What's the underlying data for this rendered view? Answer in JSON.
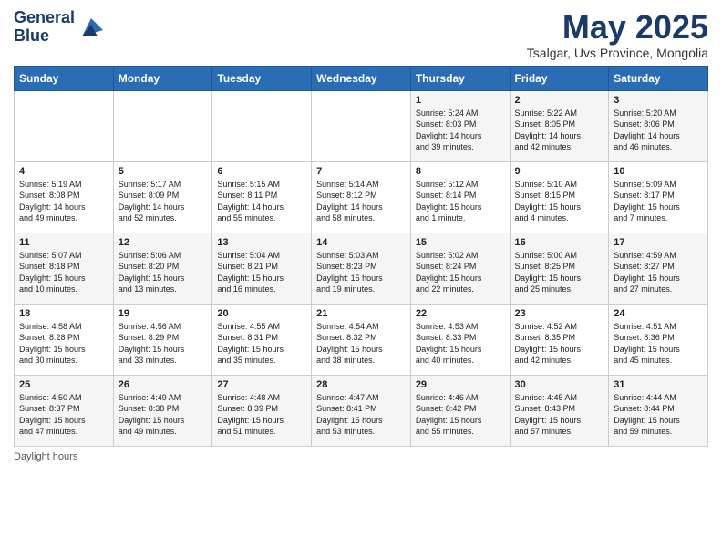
{
  "header": {
    "logo_line1": "General",
    "logo_line2": "Blue",
    "title": "May 2025",
    "subtitle": "Tsalgar, Uvs Province, Mongolia"
  },
  "weekdays": [
    "Sunday",
    "Monday",
    "Tuesday",
    "Wednesday",
    "Thursday",
    "Friday",
    "Saturday"
  ],
  "weeks": [
    [
      {
        "day": "",
        "info": ""
      },
      {
        "day": "",
        "info": ""
      },
      {
        "day": "",
        "info": ""
      },
      {
        "day": "",
        "info": ""
      },
      {
        "day": "1",
        "info": "Sunrise: 5:24 AM\nSunset: 8:03 PM\nDaylight: 14 hours\nand 39 minutes."
      },
      {
        "day": "2",
        "info": "Sunrise: 5:22 AM\nSunset: 8:05 PM\nDaylight: 14 hours\nand 42 minutes."
      },
      {
        "day": "3",
        "info": "Sunrise: 5:20 AM\nSunset: 8:06 PM\nDaylight: 14 hours\nand 46 minutes."
      }
    ],
    [
      {
        "day": "4",
        "info": "Sunrise: 5:19 AM\nSunset: 8:08 PM\nDaylight: 14 hours\nand 49 minutes."
      },
      {
        "day": "5",
        "info": "Sunrise: 5:17 AM\nSunset: 8:09 PM\nDaylight: 14 hours\nand 52 minutes."
      },
      {
        "day": "6",
        "info": "Sunrise: 5:15 AM\nSunset: 8:11 PM\nDaylight: 14 hours\nand 55 minutes."
      },
      {
        "day": "7",
        "info": "Sunrise: 5:14 AM\nSunset: 8:12 PM\nDaylight: 14 hours\nand 58 minutes."
      },
      {
        "day": "8",
        "info": "Sunrise: 5:12 AM\nSunset: 8:14 PM\nDaylight: 15 hours\nand 1 minute."
      },
      {
        "day": "9",
        "info": "Sunrise: 5:10 AM\nSunset: 8:15 PM\nDaylight: 15 hours\nand 4 minutes."
      },
      {
        "day": "10",
        "info": "Sunrise: 5:09 AM\nSunset: 8:17 PM\nDaylight: 15 hours\nand 7 minutes."
      }
    ],
    [
      {
        "day": "11",
        "info": "Sunrise: 5:07 AM\nSunset: 8:18 PM\nDaylight: 15 hours\nand 10 minutes."
      },
      {
        "day": "12",
        "info": "Sunrise: 5:06 AM\nSunset: 8:20 PM\nDaylight: 15 hours\nand 13 minutes."
      },
      {
        "day": "13",
        "info": "Sunrise: 5:04 AM\nSunset: 8:21 PM\nDaylight: 15 hours\nand 16 minutes."
      },
      {
        "day": "14",
        "info": "Sunrise: 5:03 AM\nSunset: 8:23 PM\nDaylight: 15 hours\nand 19 minutes."
      },
      {
        "day": "15",
        "info": "Sunrise: 5:02 AM\nSunset: 8:24 PM\nDaylight: 15 hours\nand 22 minutes."
      },
      {
        "day": "16",
        "info": "Sunrise: 5:00 AM\nSunset: 8:25 PM\nDaylight: 15 hours\nand 25 minutes."
      },
      {
        "day": "17",
        "info": "Sunrise: 4:59 AM\nSunset: 8:27 PM\nDaylight: 15 hours\nand 27 minutes."
      }
    ],
    [
      {
        "day": "18",
        "info": "Sunrise: 4:58 AM\nSunset: 8:28 PM\nDaylight: 15 hours\nand 30 minutes."
      },
      {
        "day": "19",
        "info": "Sunrise: 4:56 AM\nSunset: 8:29 PM\nDaylight: 15 hours\nand 33 minutes."
      },
      {
        "day": "20",
        "info": "Sunrise: 4:55 AM\nSunset: 8:31 PM\nDaylight: 15 hours\nand 35 minutes."
      },
      {
        "day": "21",
        "info": "Sunrise: 4:54 AM\nSunset: 8:32 PM\nDaylight: 15 hours\nand 38 minutes."
      },
      {
        "day": "22",
        "info": "Sunrise: 4:53 AM\nSunset: 8:33 PM\nDaylight: 15 hours\nand 40 minutes."
      },
      {
        "day": "23",
        "info": "Sunrise: 4:52 AM\nSunset: 8:35 PM\nDaylight: 15 hours\nand 42 minutes."
      },
      {
        "day": "24",
        "info": "Sunrise: 4:51 AM\nSunset: 8:36 PM\nDaylight: 15 hours\nand 45 minutes."
      }
    ],
    [
      {
        "day": "25",
        "info": "Sunrise: 4:50 AM\nSunset: 8:37 PM\nDaylight: 15 hours\nand 47 minutes."
      },
      {
        "day": "26",
        "info": "Sunrise: 4:49 AM\nSunset: 8:38 PM\nDaylight: 15 hours\nand 49 minutes."
      },
      {
        "day": "27",
        "info": "Sunrise: 4:48 AM\nSunset: 8:39 PM\nDaylight: 15 hours\nand 51 minutes."
      },
      {
        "day": "28",
        "info": "Sunrise: 4:47 AM\nSunset: 8:41 PM\nDaylight: 15 hours\nand 53 minutes."
      },
      {
        "day": "29",
        "info": "Sunrise: 4:46 AM\nSunset: 8:42 PM\nDaylight: 15 hours\nand 55 minutes."
      },
      {
        "day": "30",
        "info": "Sunrise: 4:45 AM\nSunset: 8:43 PM\nDaylight: 15 hours\nand 57 minutes."
      },
      {
        "day": "31",
        "info": "Sunrise: 4:44 AM\nSunset: 8:44 PM\nDaylight: 15 hours\nand 59 minutes."
      }
    ]
  ],
  "footer": {
    "note": "Daylight hours"
  }
}
